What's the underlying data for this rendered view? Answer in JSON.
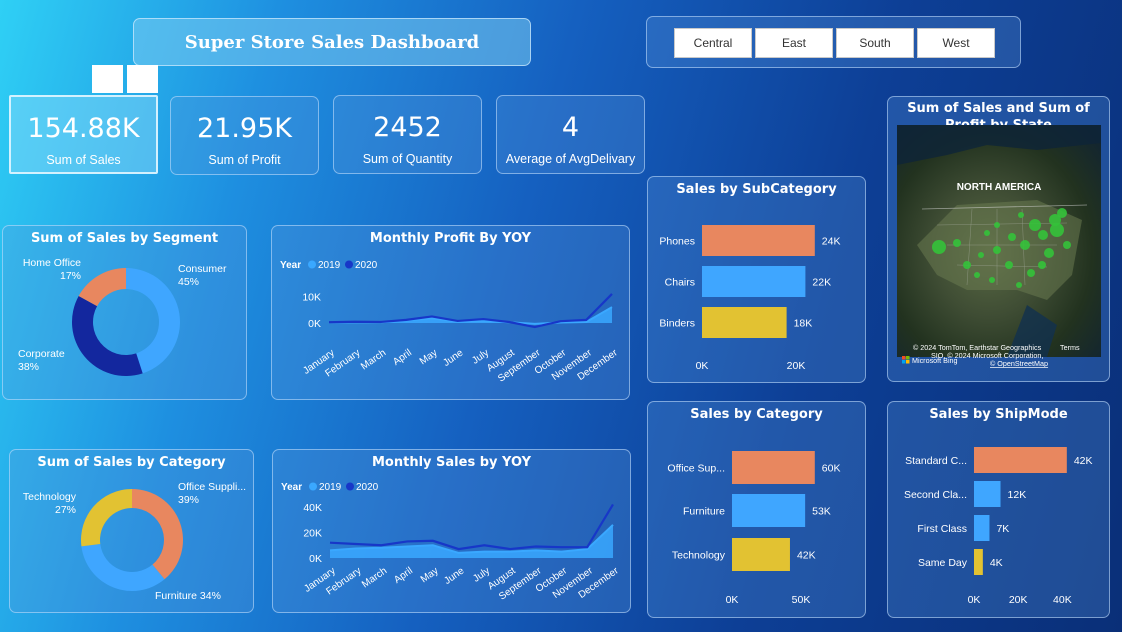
{
  "dashboard": {
    "title": "Super Store Sales Dashboard"
  },
  "regions": [
    "Central",
    "East",
    "South",
    "West"
  ],
  "kpis": [
    {
      "value": "154.88K",
      "label": "Sum of Sales"
    },
    {
      "value": "21.95K",
      "label": "Sum of Profit"
    },
    {
      "value": "2452",
      "label": "Sum of Quantity"
    },
    {
      "value": "4",
      "label": "Average of AvgDelivary"
    }
  ],
  "colors": {
    "orange": "#e8875f",
    "blue": "#3fa6ff",
    "navy": "#13279e",
    "yellow": "#e2c232",
    "line2020": "#1737c8",
    "line2019": "#3aa8ff"
  },
  "map": {
    "title": "Sum of Sales and Sum of Profit by State",
    "continent_label": "NORTH AMERICA",
    "attribution1": "© 2024 TomTom, Earthstar Geographics",
    "attribution2": "SIO, © 2024 Microsoft Corporation,",
    "terms": "Terms",
    "osm": "© OpenStreetMap",
    "bing": "Microsoft Bing"
  },
  "chart_data": [
    {
      "type": "pie",
      "title": "Sum of Sales by Segment",
      "categories": [
        "Consumer",
        "Corporate",
        "Home Office"
      ],
      "values": [
        45,
        38,
        17
      ],
      "labels": [
        "Consumer\n45%",
        "Corporate\n38%",
        "Home Office\n17%"
      ],
      "colors": [
        "#3fa6ff",
        "#13279e",
        "#e8875f"
      ],
      "donut": true
    },
    {
      "type": "line",
      "title": "Monthly Profit By YOY",
      "legend_title": "Year",
      "x": [
        "January",
        "February",
        "March",
        "April",
        "May",
        "June",
        "July",
        "August",
        "September",
        "October",
        "November",
        "December"
      ],
      "series": [
        {
          "name": "2019",
          "values": [
            200,
            250,
            300,
            900,
            1800,
            500,
            800,
            300,
            -300,
            200,
            400,
            6000
          ],
          "style": "area"
        },
        {
          "name": "2020",
          "values": [
            300,
            500,
            400,
            1200,
            2500,
            800,
            1500,
            400,
            -1500,
            700,
            1200,
            11000
          ]
        }
      ],
      "y_ticks": [
        "0K",
        "10K"
      ],
      "ylim": [
        -3000,
        14000
      ]
    },
    {
      "type": "bar",
      "orientation": "horizontal",
      "title": "Sales by SubCategory",
      "categories": [
        "Phones",
        "Chairs",
        "Binders"
      ],
      "values": [
        24,
        22,
        18
      ],
      "value_labels": [
        "24K",
        "22K",
        "18K"
      ],
      "colors": [
        "#e8875f",
        "#3fa6ff",
        "#e2c232"
      ],
      "x_ticks": [
        "0K",
        "20K"
      ],
      "xlim": [
        0,
        20
      ]
    },
    {
      "type": "pie",
      "title": "Sum of Sales by Category",
      "categories": [
        "Office Supplies",
        "Furniture",
        "Technology"
      ],
      "values": [
        39,
        34,
        27
      ],
      "labels": [
        "Office Suppli...\n39%",
        "Furniture 34%",
        "Technology\n27%"
      ],
      "colors": [
        "#e8875f",
        "#3fa6ff",
        "#e2c232"
      ],
      "donut": true
    },
    {
      "type": "line",
      "title": "Monthly Sales by YOY",
      "legend_title": "Year",
      "x": [
        "January",
        "February",
        "March",
        "April",
        "May",
        "June",
        "July",
        "August",
        "September",
        "October",
        "November",
        "December"
      ],
      "series": [
        {
          "name": "2019",
          "values": [
            6000,
            7500,
            8000,
            9000,
            10000,
            4000,
            5000,
            5000,
            6000,
            5000,
            7000,
            26000
          ],
          "style": "area"
        },
        {
          "name": "2020",
          "values": [
            12000,
            11000,
            10000,
            13000,
            13500,
            7000,
            10000,
            7000,
            9000,
            8500,
            8500,
            42000
          ]
        }
      ],
      "y_ticks": [
        "0K",
        "20K",
        "40K"
      ],
      "ylim": [
        0,
        40000
      ]
    },
    {
      "type": "bar",
      "orientation": "horizontal",
      "title": "Sales by Category",
      "categories": [
        "Office Sup...",
        "Furniture",
        "Technology"
      ],
      "values": [
        60,
        53,
        42
      ],
      "value_labels": [
        "60K",
        "53K",
        "42K"
      ],
      "colors": [
        "#e8875f",
        "#3fa6ff",
        "#e2c232"
      ],
      "x_ticks": [
        "0K",
        "50K"
      ],
      "xlim": [
        0,
        50
      ]
    },
    {
      "type": "bar",
      "orientation": "horizontal",
      "title": "Sales by ShipMode",
      "categories": [
        "Standard C...",
        "Second Cla...",
        "First Class",
        "Same Day"
      ],
      "values": [
        42,
        12,
        7,
        4
      ],
      "value_labels": [
        "42K",
        "12K",
        "7K",
        "4K"
      ],
      "colors": [
        "#e8875f",
        "#3fa6ff",
        "#3fa6ff",
        "#e2c232"
      ],
      "x_ticks": [
        "0K",
        "20K",
        "40K"
      ],
      "xlim": [
        0,
        40
      ]
    }
  ]
}
